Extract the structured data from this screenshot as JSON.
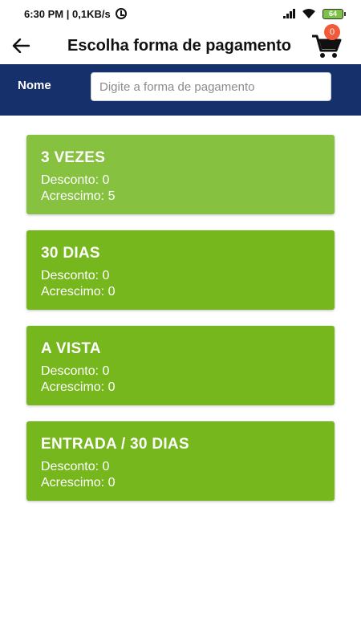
{
  "status_bar": {
    "time_speed": "6:30 PM | 0,1KB/s",
    "battery": "64"
  },
  "app_bar": {
    "title": "Escolha forma de pagamento",
    "cart_count": "0"
  },
  "filter": {
    "label": "Nome",
    "placeholder": "Digite a forma de pagamento",
    "value": ""
  },
  "payment_options": [
    {
      "name": "3 VEZES",
      "desconto_label": "Desconto:",
      "desconto": "0",
      "acrescimo_label": "Acrescimo:",
      "acrescimo": "5"
    },
    {
      "name": "30 DIAS",
      "desconto_label": "Desconto:",
      "desconto": "0",
      "acrescimo_label": "Acrescimo:",
      "acrescimo": "0"
    },
    {
      "name": "A VISTA",
      "desconto_label": "Desconto:",
      "desconto": "0",
      "acrescimo_label": "Acrescimo:",
      "acrescimo": "0"
    },
    {
      "name": "ENTRADA / 30 DIAS",
      "desconto_label": "Desconto:",
      "desconto": "0",
      "acrescimo_label": "Acrescimo:",
      "acrescimo": "0"
    }
  ],
  "colors": {
    "header_blue": "#15306a",
    "card_green": "#76b71e",
    "card_green_light": "#86c23f",
    "badge_red": "#f15a3a"
  },
  "icons": [
    "alarm-icon",
    "signal-icon",
    "wifi-icon",
    "battery-icon",
    "arrow-back-icon",
    "shopping-cart-icon"
  ]
}
